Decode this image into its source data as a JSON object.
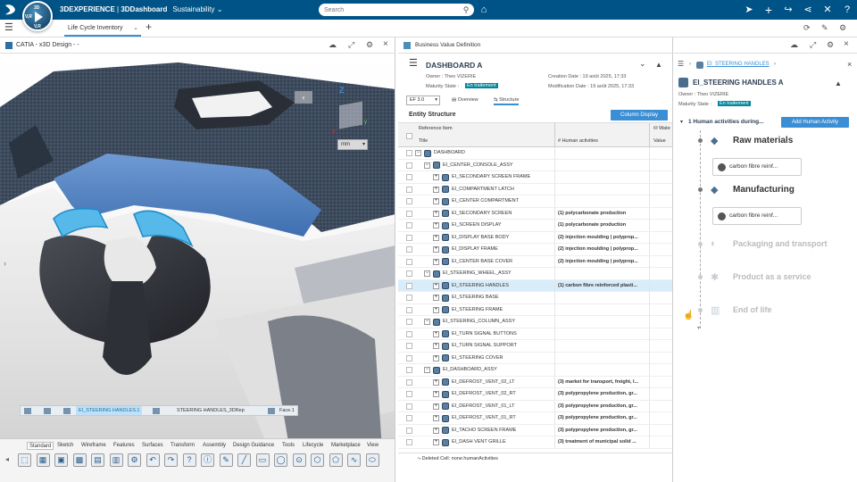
{
  "app": {
    "brand": "3DEXPERIENCE",
    "separator": " | ",
    "dashboard": "3DDashboard",
    "context": "Sustainability",
    "compass_top": "3D",
    "compass_left": "V,R",
    "compass_bottom": "V,R",
    "search_placeholder": "Search"
  },
  "tabs": {
    "active": "Life Cycle Inventory",
    "add": "+"
  },
  "catia": {
    "title": "CATIA - x3D Design - -",
    "cube_axis": "Z",
    "cube_axis_y": "y",
    "cube_axis_x": "x",
    "view_mode": "mm",
    "breadcrumb": [
      "EI_STEERING HANDLES.1",
      "STEERING HANDLES_3DRep",
      "Face.1"
    ],
    "toolbar_tabs": [
      "Standard",
      "Sketch",
      "Wireframe",
      "Features",
      "Surfaces",
      "Transform",
      "Assembly",
      "Design Guidance",
      "Tools",
      "Lifecycle",
      "Marketplace",
      "View"
    ]
  },
  "bvd": {
    "panel_title": "Business Value Definition",
    "object_title": "DASHBOARD A",
    "owner_label": "Owner :",
    "owner": "Theo VIZERIE",
    "maturity_label": "Maturity State :",
    "maturity": "En traitement",
    "creation_label": "Creation Date :",
    "creation": "19 août 2025, 17:33",
    "modification_label": "Modification Date :",
    "modification": "19 août 2025, 17:33",
    "version": "EF 3.0",
    "tab_overview": "Overview",
    "tab_structure": "Structure",
    "entity_structure": "Entity Structure",
    "column_display": "Column Display",
    "col_reference": "Reference Item",
    "col_title": "Title",
    "col_human": "# Human activities",
    "col_water": "Wate",
    "col_value": "Value",
    "status": "Deleted Cell: none.humanActivities",
    "rows": [
      {
        "label": "DASHBOARD",
        "human": "",
        "level": 0,
        "exp": "−"
      },
      {
        "label": "EI_CENTER_CONSOLE_ASSY",
        "human": "",
        "level": 1,
        "exp": "−"
      },
      {
        "label": "EI_SECONDARY SCREEN FRAME",
        "human": "",
        "level": 2,
        "exp": "+"
      },
      {
        "label": "EI_COMPARTMENT LATCH",
        "human": "",
        "level": 2,
        "exp": "+"
      },
      {
        "label": "EI_CENTER COMPARTMENT",
        "human": "",
        "level": 2,
        "exp": "+"
      },
      {
        "label": "EI_SECONDARY SCREEN",
        "human": "(1) polycarbonate production",
        "level": 2,
        "exp": "+"
      },
      {
        "label": "EI_SCREEN DISPLAY",
        "human": "(1) polycarbonate production",
        "level": 2,
        "exp": "+"
      },
      {
        "label": "EI_DISPLAY BASE BODY",
        "human": "(2) injection moulding | polyprop...",
        "level": 2,
        "exp": "+"
      },
      {
        "label": "EI_DISPLAY FRAME",
        "human": "(2) injection moulding | polyprop...",
        "level": 2,
        "exp": "+"
      },
      {
        "label": "EI_CENTER BASE COVER",
        "human": "(2) injection moulding | polyprop...",
        "level": 2,
        "exp": "+"
      },
      {
        "label": "EI_STEERING_WHEEL_ASSY",
        "human": "",
        "level": 1,
        "exp": "−"
      },
      {
        "label": "EI_STEERING HANDLES",
        "human": "(1) carbon fibre reinforced plasti...",
        "level": 2,
        "exp": "+",
        "selected": true
      },
      {
        "label": "EI_STEERING BASE",
        "human": "",
        "level": 2,
        "exp": "+"
      },
      {
        "label": "EI_STEERING FRAME",
        "human": "",
        "level": 2,
        "exp": "+"
      },
      {
        "label": "EI_STEERING_COLUMN_ASSY",
        "human": "",
        "level": 1,
        "exp": "−"
      },
      {
        "label": "EI_TURN SIGNAL BUTTONS",
        "human": "",
        "level": 2,
        "exp": "+"
      },
      {
        "label": "EI_TURN SIGNAL SUPPORT",
        "human": "",
        "level": 2,
        "exp": "+"
      },
      {
        "label": "EI_STEERING COVER",
        "human": "",
        "level": 2,
        "exp": "+"
      },
      {
        "label": "EI_DASHBOARD_ASSY",
        "human": "",
        "level": 1,
        "exp": "−"
      },
      {
        "label": "EI_DEFROST_VENT_02_LT",
        "human": "(3) market for transport, freight, l...",
        "level": 2,
        "exp": "+"
      },
      {
        "label": "EI_DEFROST_VENT_02_RT",
        "human": "(3) polypropylene production, gr...",
        "level": 2,
        "exp": "+"
      },
      {
        "label": "EI_DEFROST_VENT_01_LT",
        "human": "(3) polypropylene production, gr...",
        "level": 2,
        "exp": "+"
      },
      {
        "label": "EI_DEFROST_VENT_01_RT",
        "human": "(3) polypropylene production, gr...",
        "level": 2,
        "exp": "+"
      },
      {
        "label": "EI_TACHO SCREEN FRAME",
        "human": "(3) polypropylene production, gr...",
        "level": 2,
        "exp": "+"
      },
      {
        "label": "EI_DASH VENT GRILLE",
        "human": "(3) treatment of municipal solid ...",
        "level": 2,
        "exp": "+"
      }
    ]
  },
  "detail": {
    "breadcrumb": "EI_STEERING HANDLES",
    "title": "EI_STEERING HANDLES A",
    "owner_label": "Owner :",
    "owner": "Theo VIZERIE",
    "maturity_label": "Maturity State :",
    "maturity": "En traitement",
    "section": "1 Human activities during...",
    "add_button": "Add Human Activity",
    "stages": [
      {
        "name": "Raw materials",
        "active": true,
        "material": "carbon fibre reinf..."
      },
      {
        "name": "Manufacturing",
        "active": true,
        "material": "carbon fibre reinf..."
      },
      {
        "name": "Packaging and transport",
        "active": false
      },
      {
        "name": "Product as a service",
        "active": false
      },
      {
        "name": "End of life",
        "active": false
      }
    ]
  },
  "colors": {
    "topbar": "#005386",
    "accent": "#3a8ed4",
    "badge": "#00879e",
    "selected_row": "#d9ecf9"
  }
}
